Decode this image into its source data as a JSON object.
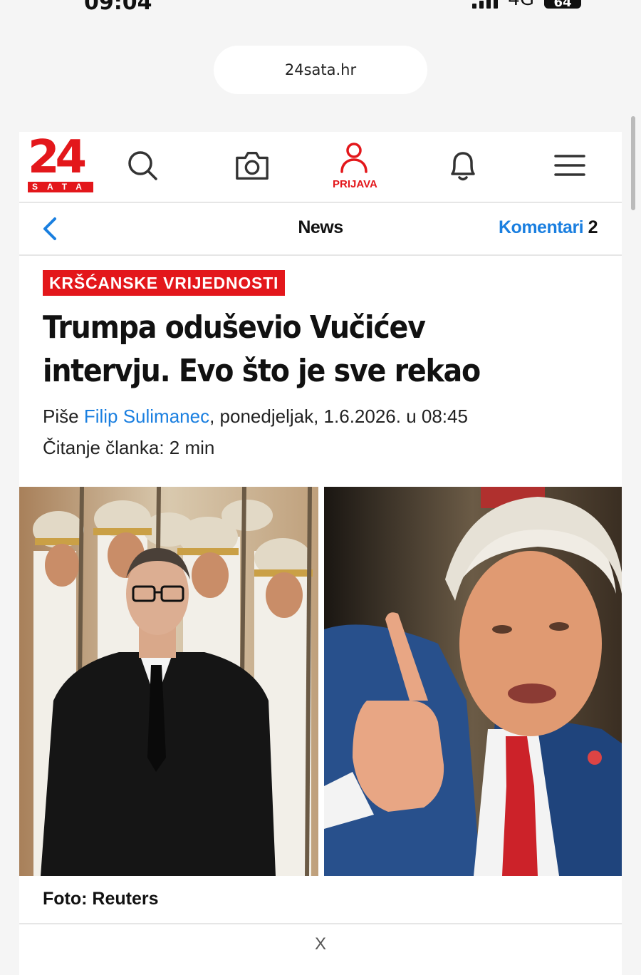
{
  "status_bar": {
    "time": "09:04",
    "network": "4G",
    "battery": "64"
  },
  "browser": {
    "url": "24sata.hr"
  },
  "header": {
    "logo_number": "24",
    "logo_sub": "SATA",
    "login_label": "PRIJAVA",
    "icons": [
      "search-icon",
      "camera-icon",
      "user-icon",
      "bell-icon",
      "menu-icon"
    ]
  },
  "subnav": {
    "section": "News",
    "comments_label": "Komentari",
    "comments_count": "2"
  },
  "article": {
    "kicker": "KRŠĆANSKE VRIJEDNOSTI",
    "headline": "Trumpa oduševio Vučićev intervju. Evo što je sve rekao",
    "byline_prefix": "Piše ",
    "author": "Filip Sulimanec",
    "byline_suffix": ", ponedjeljak, 1.6.2026. u 08:45",
    "read_time": "Čitanje članka: 2 min",
    "photo_caption": "Foto: Reuters"
  },
  "ad": {
    "close_label": "X"
  },
  "colors": {
    "brand_red": "#e3171b",
    "link_blue": "#1a7fe0"
  }
}
